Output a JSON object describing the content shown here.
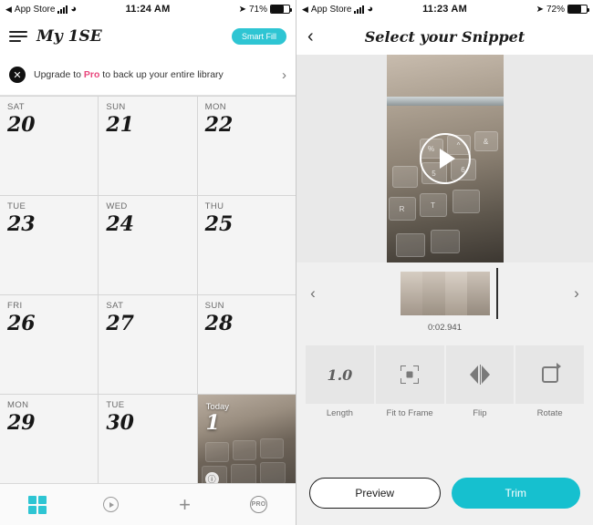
{
  "left": {
    "status": {
      "carrier": "App Store",
      "time": "11:24 AM",
      "battery": "71%"
    },
    "nav": {
      "title": "My 1SE",
      "smart_fill": "Smart Fill",
      "menu_icon": "hamburger-icon"
    },
    "banner": {
      "close_icon": "close-icon",
      "text_before": "Upgrade to ",
      "highlight": "Pro",
      "text_after": " to back up your entire library",
      "chevron": "›",
      "accent": "#e8467c"
    },
    "calendar": [
      {
        "dow": "SAT",
        "num": "20"
      },
      {
        "dow": "SUN",
        "num": "21"
      },
      {
        "dow": "MON",
        "num": "22"
      },
      {
        "dow": "TUE",
        "num": "23"
      },
      {
        "dow": "WED",
        "num": "24"
      },
      {
        "dow": "THU",
        "num": "25"
      },
      {
        "dow": "FRI",
        "num": "26"
      },
      {
        "dow": "SAT",
        "num": "27"
      },
      {
        "dow": "SUN",
        "num": "28"
      },
      {
        "dow": "MON",
        "num": "29"
      },
      {
        "dow": "TUE",
        "num": "30"
      },
      {
        "dow": "Today",
        "num": "1",
        "photo": true,
        "badge": "ⓘ"
      }
    ],
    "tabs": [
      {
        "name": "grid",
        "icon": "grid-icon",
        "active": true
      },
      {
        "name": "play",
        "icon": "play-circle-icon",
        "active": false
      },
      {
        "name": "add",
        "icon": "plus-icon",
        "active": false
      },
      {
        "name": "pro",
        "icon": "pro-badge-icon",
        "label": "PRO",
        "active": false
      }
    ],
    "accent": "#2ec5d3"
  },
  "right": {
    "status": {
      "carrier": "App Store",
      "time": "11:23 AM",
      "battery": "72%"
    },
    "nav": {
      "back_icon": "back-chevron-icon",
      "title": "Select your Snippet"
    },
    "video": {
      "play_icon": "play-icon",
      "keys": [
        "%",
        "^",
        "&",
        "R",
        "T",
        "5",
        "6"
      ]
    },
    "trim": {
      "prev_icon": "chevron-left-icon",
      "next_icon": "chevron-right-icon",
      "time": "0:02.941"
    },
    "tools": [
      {
        "label": "Length",
        "value": "1.0",
        "icon": "speed-text-icon"
      },
      {
        "label": "Fit to Frame",
        "icon": "fit-to-frame-icon"
      },
      {
        "label": "Flip",
        "icon": "flip-icon"
      },
      {
        "label": "Rotate",
        "icon": "rotate-icon"
      }
    ],
    "buttons": {
      "preview": "Preview",
      "trim": "Trim"
    },
    "accent": "#16c0cf"
  }
}
